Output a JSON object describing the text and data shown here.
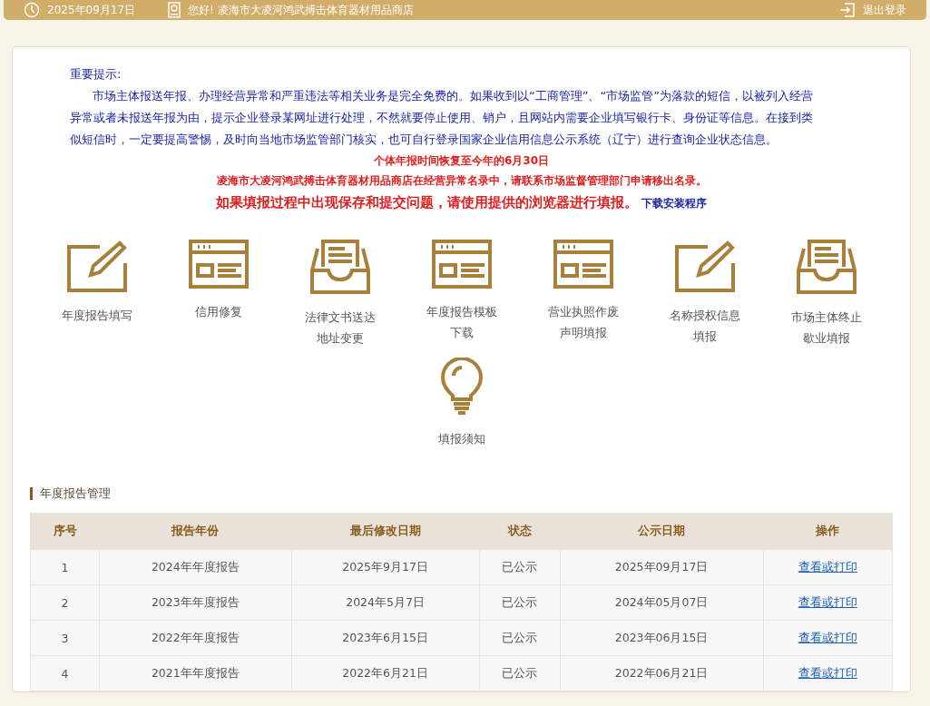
{
  "top_bar": {
    "date": "2025年09月17日",
    "greeting": "您好! 凌海市大凌河鸿武搏击体育器材用品商店",
    "logout": "退出登录"
  },
  "notice": {
    "heading": "重要提示:",
    "paragraph": "市场主体报送年报、办理经营异常和严重违法等相关业务是完全免费的。如果收到以“工商管理”、“市场监管”为落款的短信，以被列入经营异常或者未报送年报为由，提示企业登录某网址进行处理，不然就要停止使用、销户，且网站内需要企业填写银行卡、身份证等信息。在接到类似短信时，一定要提高警惕，及时向当地市场监管部门核实，也可自行登录国家企业信用信息公示系统（辽宁）进行查询企业状态信息。",
    "alerts": [
      "个体年报时间恢复至今年的6月30日",
      "凌海市大凌河鸿武搏击体育器材用品商店在经营异常名录中，请联系市场监督管理部门申请移出名录。"
    ],
    "browser_note": "如果填报过程中出现保存和提交问题，请使用提供的浏览器进行填报。",
    "download_link": "下载安装程序"
  },
  "services": [
    {
      "kind": "pencil",
      "label": [
        "年度报告填写"
      ]
    },
    {
      "kind": "window",
      "label": [
        "信用修复"
      ]
    },
    {
      "kind": "tray",
      "label": [
        "法律文书送达",
        "地址变更"
      ]
    },
    {
      "kind": "window",
      "label": [
        "年度报告模板",
        "下载"
      ]
    },
    {
      "kind": "window",
      "label": [
        "营业执照作废",
        "声明填报"
      ]
    },
    {
      "kind": "pencil",
      "label": [
        "名称授权信息",
        "填报"
      ]
    },
    {
      "kind": "tray",
      "label": [
        "市场主体终止",
        "歇业填报"
      ]
    },
    {
      "kind": "bulb",
      "label": [
        "填报须知"
      ]
    }
  ],
  "section_title": "年度报告管理",
  "table": {
    "columns": [
      "序号",
      "报告年份",
      "最后修改日期",
      "状态",
      "公示日期",
      "操作"
    ],
    "rows": [
      [
        "1",
        "2024年年度报告",
        "2025年9月17日",
        "已公示",
        "2025年09月17日",
        "查看或打印"
      ],
      [
        "2",
        "2023年年度报告",
        "2024年5月7日",
        "已公示",
        "2024年05月07日",
        "查看或打印"
      ],
      [
        "3",
        "2022年年度报告",
        "2023年6月15日",
        "已公示",
        "2023年06月15日",
        "查看或打印"
      ],
      [
        "4",
        "2021年年度报告",
        "2022年6月21日",
        "已公示",
        "2022年06月21日",
        "查看或打印"
      ]
    ]
  }
}
